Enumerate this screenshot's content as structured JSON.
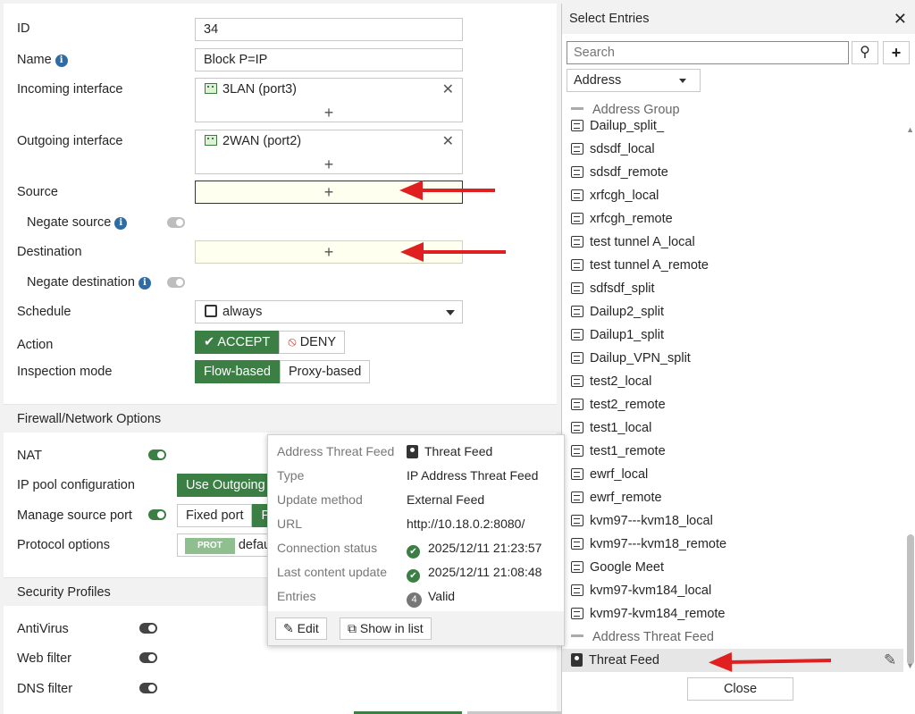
{
  "form": {
    "id_label": "ID",
    "id_value": "34",
    "name_label": "Name",
    "name_value": "Block P=IP",
    "incoming_label": "Incoming interface",
    "incoming_value": "3LAN (port3)",
    "outgoing_label": "Outgoing interface",
    "outgoing_value": "2WAN (port2)",
    "source_label": "Source",
    "negate_source_label": "Negate source",
    "destination_label": "Destination",
    "negate_destination_label": "Negate destination",
    "schedule_label": "Schedule",
    "schedule_value": "always",
    "action_label": "Action",
    "accept_label": "ACCEPT",
    "deny_label": "DENY",
    "inspection_label": "Inspection mode",
    "flow_label": "Flow-based",
    "proxy_label": "Proxy-based",
    "plus": "+",
    "close_x": "✕"
  },
  "firewall": {
    "section_title": "Firewall/Network Options",
    "nat_label": "NAT",
    "ippool_label": "IP pool configuration",
    "ippool_value": "Use Outgoing",
    "manage_port_label": "Manage source port",
    "fixed_port_label": "Fixed port",
    "fixed_port_other": "P",
    "protocol_label": "Protocol options",
    "prot_badge": "PROT",
    "protocol_value": "defau"
  },
  "security": {
    "section_title": "Security Profiles",
    "antivirus_label": "AntiVirus",
    "webfilter_label": "Web filter",
    "dnsfilter_label": "DNS filter"
  },
  "tooltip": {
    "rows": [
      {
        "key": "Address Threat Feed",
        "value": "Threat Feed"
      },
      {
        "key": "Type",
        "value": "IP Address Threat Feed"
      },
      {
        "key": "Update method",
        "value": "External Feed"
      },
      {
        "key": "URL",
        "value": "http://10.18.0.2:8080/"
      },
      {
        "key": "Connection status",
        "value": "2025/12/11 21:23:57"
      },
      {
        "key": "Last content update",
        "value": "2025/12/11 21:08:48"
      },
      {
        "key": "Entries",
        "value": "Valid"
      }
    ],
    "entries_count": "4",
    "edit_label": "Edit",
    "show_list_label": "Show in list"
  },
  "panel": {
    "title": "Select Entries",
    "close_x": "✕",
    "search_placeholder": "Search",
    "add_symbol": "+",
    "type_select": "Address",
    "group_address": "Address Group",
    "items": [
      "Dailup_split_",
      "sdsdf_local",
      "sdsdf_remote",
      "xrfcgh_local",
      "xrfcgh_remote",
      "test tunnel A_local",
      "test tunnel A_remote",
      "sdfsdf_split",
      "Dailup2_split",
      "Dailup1_split",
      "Dailup_VPN_split",
      "test2_local",
      "test2_remote",
      "test1_local",
      "test1_remote",
      "ewrf_local",
      "ewrf_remote",
      "kvm97---kvm18_local",
      "kvm97---kvm18_remote",
      "Google Meet",
      "kvm97-kvm184_local",
      "kvm97-kvm184_remote"
    ],
    "group_threat": "Address Threat Feed",
    "threat_item": "Threat Feed",
    "close_button": "Close"
  },
  "colors": {
    "accent_green": "#3b7f45",
    "annotation_red": "#e02020",
    "info_blue": "#2f6ca4",
    "add_box_bg": "#fffff0"
  }
}
